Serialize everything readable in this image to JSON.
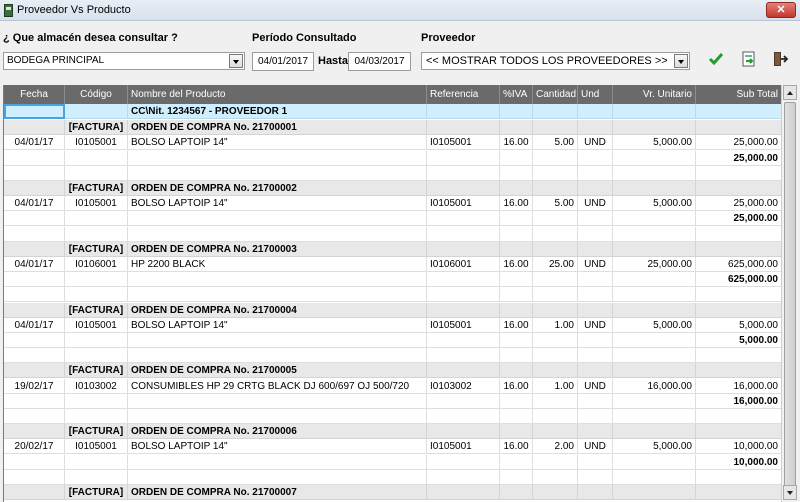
{
  "window": {
    "title": "Proveedor Vs Producto",
    "close_label": "✕"
  },
  "filters": {
    "warehouse_label": "¿ Que almacén desea consultar ?",
    "warehouse_value": "BODEGA PRINCIPAL",
    "period_label": "Período Consultado",
    "date_from": "04/01/2017",
    "until_label": "Hasta",
    "date_to": "04/03/2017",
    "supplier_label": "Proveedor",
    "supplier_value": "<< MOSTRAR TODOS LOS PROVEEDORES >>"
  },
  "toolbar": {
    "icons": [
      "check-icon",
      "export-icon",
      "exit-icon"
    ]
  },
  "columns": [
    "Fecha",
    "Código",
    "Nombre del Producto",
    "Referencia",
    "%IVA",
    "Cantidad",
    "Und",
    "Vr. Unitario",
    "Sub Total"
  ],
  "supplier_row": "CC\\Nit. 1234567 - PROVEEDOR 1",
  "order_tag": "[FACTURA]",
  "orders": [
    {
      "title": "ORDEN DE COMPRA No. 21700001",
      "fecha": "04/01/17",
      "codigo": "I0105001",
      "producto": "BOLSO LAPTOIP 14\"",
      "referencia": "I0105001",
      "iva": "16.00",
      "cantidad": "5.00",
      "und": "UND",
      "unitario": "5,000.00",
      "subtotal": "25,000.00",
      "total": "25,000.00"
    },
    {
      "title": "ORDEN DE COMPRA No. 21700002",
      "fecha": "04/01/17",
      "codigo": "I0105001",
      "producto": "BOLSO LAPTOIP 14\"",
      "referencia": "I0105001",
      "iva": "16.00",
      "cantidad": "5.00",
      "und": "UND",
      "unitario": "5,000.00",
      "subtotal": "25,000.00",
      "total": "25,000.00"
    },
    {
      "title": "ORDEN DE COMPRA No. 21700003",
      "fecha": "04/01/17",
      "codigo": "I0106001",
      "producto": "HP 2200 BLACK",
      "referencia": "I0106001",
      "iva": "16.00",
      "cantidad": "25.00",
      "und": "UND",
      "unitario": "25,000.00",
      "subtotal": "625,000.00",
      "total": "625,000.00"
    },
    {
      "title": "ORDEN DE COMPRA No. 21700004",
      "fecha": "04/01/17",
      "codigo": "I0105001",
      "producto": "BOLSO LAPTOIP 14\"",
      "referencia": "I0105001",
      "iva": "16.00",
      "cantidad": "1.00",
      "und": "UND",
      "unitario": "5,000.00",
      "subtotal": "5,000.00",
      "total": "5,000.00"
    },
    {
      "title": "ORDEN DE COMPRA No. 21700005",
      "fecha": "19/02/17",
      "codigo": "I0103002",
      "producto": "CONSUMIBLES HP 29 CRTG BLACK DJ 600/697 OJ 500/720",
      "referencia": "I0103002",
      "iva": "16.00",
      "cantidad": "1.00",
      "und": "UND",
      "unitario": "16,000.00",
      "subtotal": "16,000.00",
      "total": "16,000.00"
    },
    {
      "title": "ORDEN DE COMPRA No. 21700006",
      "fecha": "20/02/17",
      "codigo": "I0105001",
      "producto": "BOLSO LAPTOIP 14\"",
      "referencia": "I0105001",
      "iva": "16.00",
      "cantidad": "2.00",
      "und": "UND",
      "unitario": "5,000.00",
      "subtotal": "10,000.00",
      "total": "10,000.00"
    },
    {
      "title": "ORDEN DE COMPRA No. 21700007"
    }
  ],
  "colors": {
    "header_bg": "#6a6a6a",
    "supplier_row_bg": "#cfefff",
    "order_row_bg": "#e8e8e8"
  }
}
